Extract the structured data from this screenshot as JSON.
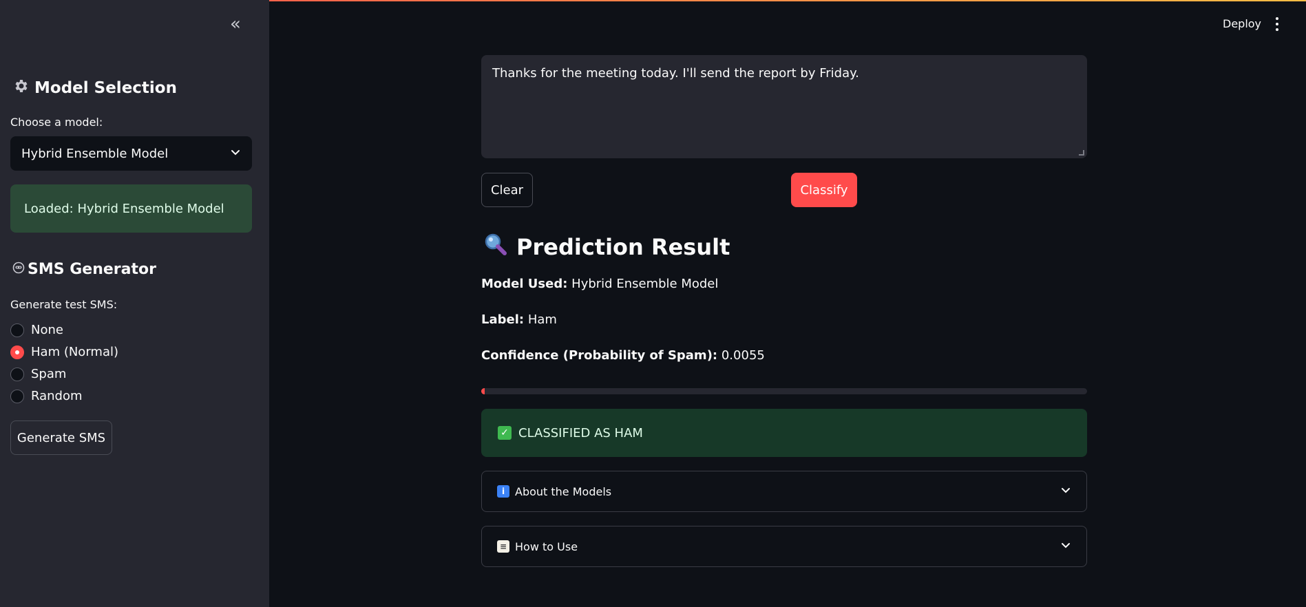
{
  "header": {
    "deploy_label": "Deploy"
  },
  "sidebar": {
    "model_section": {
      "icon": "gear-icon",
      "title": "Model Selection",
      "select_label": "Choose a model:",
      "selected_model": "Hybrid Ensemble Model",
      "status": "Loaded: Hybrid Ensemble Model"
    },
    "sms_section": {
      "icon": "robot-icon",
      "title": "SMS Generator",
      "radio_label": "Generate test SMS:",
      "options": [
        "None",
        "Ham (Normal)",
        "Spam",
        "Random"
      ],
      "selected": "Ham (Normal)",
      "generate_label": "Generate SMS"
    }
  },
  "main": {
    "message_text": "Thanks for the meeting today. I'll send the report by Friday.",
    "clear_label": "Clear",
    "classify_label": "Classify",
    "result": {
      "icon": "magnifier-icon",
      "title": "Prediction Result",
      "model_used_key": "Model Used:",
      "model_used_value": "Hybrid Ensemble Model",
      "label_key": "Label:",
      "label_value": "Ham",
      "confidence_key": "Confidence (Probability of Spam):",
      "confidence_value": "0.0055",
      "spam_probability": 0.0055,
      "verdict": "CLASSIFIED AS HAM"
    },
    "expanders": [
      {
        "icon": "info-icon",
        "label": "About the Models"
      },
      {
        "icon": "memo-icon",
        "label": "How to Use"
      }
    ]
  },
  "colors": {
    "accent": "#ff4b4b",
    "success_bg": "#173928",
    "sidebar_bg": "#262730",
    "main_bg": "#0e1117"
  }
}
